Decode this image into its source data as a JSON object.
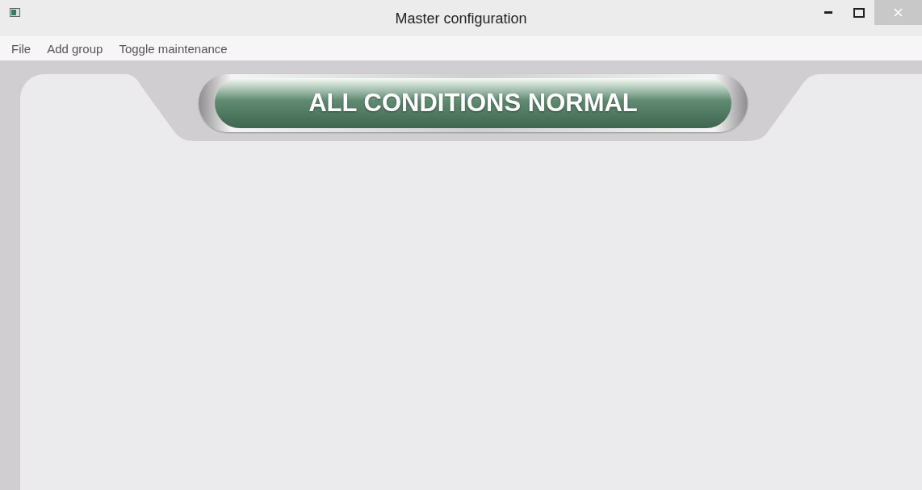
{
  "window": {
    "title": "Master configuration"
  },
  "menu": [
    "File",
    "Add group",
    "Toggle maintenance"
  ],
  "status": {
    "text": "ALL CONDITIONS NORMAL",
    "kind": "normal"
  }
}
